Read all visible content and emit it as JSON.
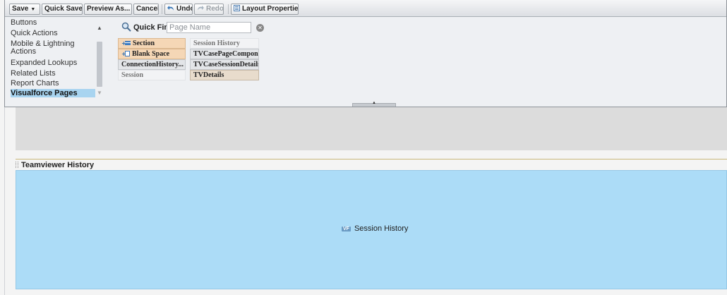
{
  "toolbar": {
    "save_label": "Save",
    "quick_save_label": "Quick Save",
    "preview_as_label": "Preview As...",
    "cancel_label": "Cancel",
    "undo_label": "Undo",
    "redo_label": "Redo",
    "layout_properties_label": "Layout Properties"
  },
  "categories": {
    "items": [
      "Buttons",
      "Quick Actions",
      "Mobile & Lightning",
      "Actions",
      "Expanded Lookups",
      "Related Lists",
      "Report Charts",
      "Visualforce Pages"
    ],
    "selected": "Visualforce Pages"
  },
  "quick_find": {
    "label": "Quick Find",
    "placeholder": "Page Name"
  },
  "palette_items": {
    "section": "Section",
    "session_history": "Session History",
    "blank_space": "Blank Space",
    "tv_case_page_component": "TVCasePageComponen",
    "connection_history": "ConnectionHistory...",
    "tv_case_session_details": "TVCaseSessionDetails",
    "session": "Session",
    "tv_details": "TVDetails"
  },
  "layout": {
    "section_title": "Teamviewer History",
    "vf_badge": "VF",
    "vf_component_label": "Session History"
  }
}
